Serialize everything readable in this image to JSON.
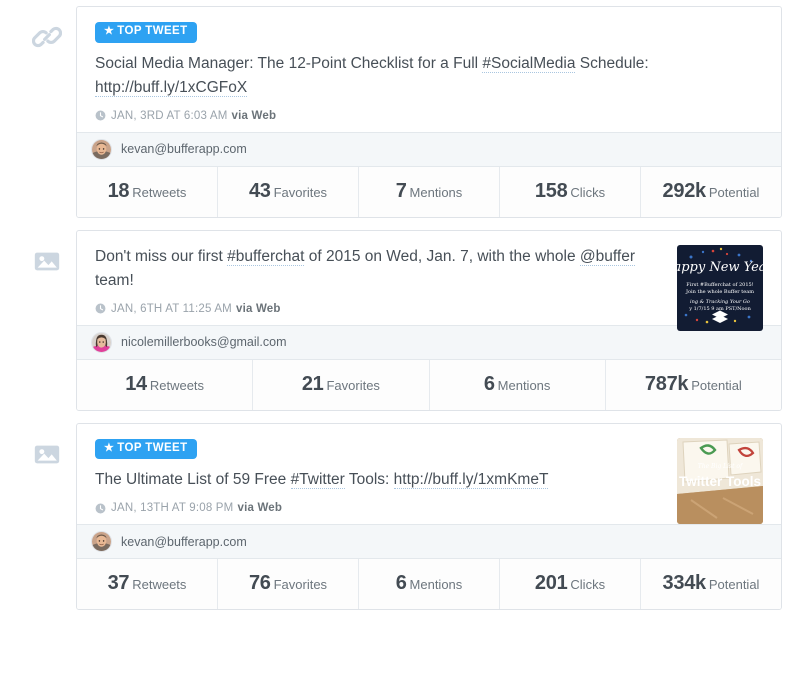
{
  "theme": {
    "badge_color": "#2ea2f2",
    "card_border": "#dfe3e8",
    "author_bar_bg": "#f4f7f9",
    "text_color": "#474f57",
    "muted_color": "#9aa3ab"
  },
  "tweets": [
    {
      "type_icon": "link-icon",
      "badge": {
        "visible": true,
        "label": "TOP TWEET"
      },
      "text_parts": [
        {
          "t": "Social Media Manager: The 12-Point Checklist for a Full ",
          "link": false
        },
        {
          "t": "#SocialMedia",
          "link": true
        },
        {
          "t": " Schedule: ",
          "link": false
        },
        {
          "t": "http://buff.ly/1xCGFoX",
          "link": true
        }
      ],
      "timestamp": "JAN, 3RD AT 6:03 AM",
      "via": "via Web",
      "has_thumbnail": false,
      "author": "kevan@bufferapp.com",
      "avatar": "avatar-kevan",
      "stats": [
        {
          "num": "18",
          "label": "Retweets"
        },
        {
          "num": "43",
          "label": "Favorites"
        },
        {
          "num": "7",
          "label": "Mentions"
        },
        {
          "num": "158",
          "label": "Clicks"
        },
        {
          "num": "292k",
          "label": "Potential"
        }
      ]
    },
    {
      "type_icon": "image-icon",
      "badge": {
        "visible": false,
        "label": "TOP TWEET"
      },
      "text_parts": [
        {
          "t": "Don't miss our first ",
          "link": false
        },
        {
          "t": "#bufferchat",
          "link": true
        },
        {
          "t": " of 2015 on Wed, Jan. 7, with the whole ",
          "link": false
        },
        {
          "t": "@buffer",
          "link": true
        },
        {
          "t": " team!",
          "link": false
        }
      ],
      "timestamp": "JAN, 6TH AT 11:25 AM",
      "via": "via Web",
      "has_thumbnail": true,
      "thumbnail": "happy-new-year-bufferchat-image",
      "thumbnail_text": {
        "headline": "appy New Yea",
        "line1": "First #Bufferchat of 2015!",
        "line2": "Join the whole Buffer team",
        "line3": "ing & Tracking Your Go",
        "line4": "y 1/7/15 9 am PST/Noon"
      },
      "author": "nicolemillerbooks@gmail.com",
      "avatar": "avatar-nicole",
      "stats": [
        {
          "num": "14",
          "label": "Retweets"
        },
        {
          "num": "21",
          "label": "Favorites"
        },
        {
          "num": "6",
          "label": "Mentions"
        },
        {
          "num": "787k",
          "label": "Potential"
        }
      ]
    },
    {
      "type_icon": "image-icon",
      "badge": {
        "visible": true,
        "label": "TOP TWEET"
      },
      "text_parts": [
        {
          "t": "The Ultimate List of 59 Free ",
          "link": false
        },
        {
          "t": "#Twitter",
          "link": true
        },
        {
          "t": " Tools: ",
          "link": false
        },
        {
          "t": "http://buff.ly/1xmKmeT",
          "link": true
        }
      ],
      "timestamp": "JAN, 13TH AT 9:08 PM",
      "via": "via Web",
      "has_thumbnail": true,
      "thumbnail": "twitter-tools-image",
      "thumbnail_text": {
        "headline": "Twitter Tools",
        "line1": "The Big List of"
      },
      "author": "kevan@bufferapp.com",
      "avatar": "avatar-kevan",
      "stats": [
        {
          "num": "37",
          "label": "Retweets"
        },
        {
          "num": "76",
          "label": "Favorites"
        },
        {
          "num": "6",
          "label": "Mentions"
        },
        {
          "num": "201",
          "label": "Clicks"
        },
        {
          "num": "334k",
          "label": "Potential"
        }
      ]
    }
  ]
}
